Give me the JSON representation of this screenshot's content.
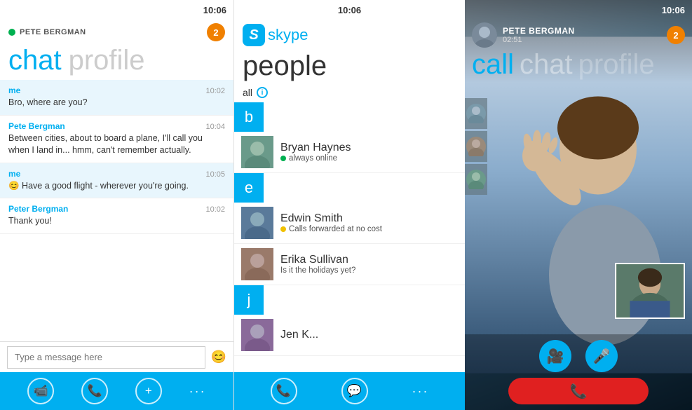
{
  "panel_chat": {
    "status_bar": {
      "time": "10:06"
    },
    "header": {
      "user_name": "PETE BERGMAN",
      "badge_count": "2"
    },
    "title": {
      "chat": "chat",
      "profile": "profile"
    },
    "messages": [
      {
        "sender": "me",
        "time": "10:02",
        "text": "Bro, where are you?",
        "highlighted": true
      },
      {
        "sender": "Pete Bergman",
        "time": "10:04",
        "text": "Between cities, about to board a plane, I'll call you when I land in... hmm, can't remember actually.",
        "highlighted": false
      },
      {
        "sender": "me",
        "time": "10:05",
        "text": "😊 Have a good flight - wherever you're going.",
        "highlighted": true
      },
      {
        "sender": "Peter Bergman",
        "time": "10:02",
        "text": "Thank you!",
        "highlighted": false
      }
    ],
    "input_placeholder": "Type a message here",
    "toolbar": {
      "btn_video": "📹",
      "btn_phone": "📞",
      "btn_add": "+",
      "dots": "..."
    }
  },
  "panel_people": {
    "status_bar": {
      "time": "10:06"
    },
    "skype_label": "skype",
    "title": "people",
    "filter": {
      "label": "all",
      "info": "i"
    },
    "sections": [
      {
        "letter": "b",
        "contacts": [
          {
            "name": "Bryan Haynes",
            "status": "always online",
            "status_type": "online"
          }
        ]
      },
      {
        "letter": "e",
        "contacts": [
          {
            "name": "Edwin Smith",
            "status": "Calls forwarded at no cost",
            "status_type": "forward"
          },
          {
            "name": "Erika Sullivan",
            "status": "Is it the holidays yet?",
            "status_type": "none"
          }
        ]
      },
      {
        "letter": "j",
        "contacts": [
          {
            "name": "Jen K...",
            "status": "",
            "status_type": "none"
          }
        ]
      }
    ],
    "toolbar": {
      "btn_phone": "📞",
      "btn_chat": "💬",
      "dots": "..."
    }
  },
  "panel_call": {
    "status_bar": {
      "time": "10:06"
    },
    "header": {
      "caller_name": "PETE BERGMAN",
      "duration": "02:51",
      "badge_count": "2"
    },
    "title": {
      "call": "call",
      "chat": "chat",
      "profile": "profile"
    },
    "controls": {
      "btn_video": "📷",
      "btn_mic": "🎤",
      "btn_end": "📞"
    }
  }
}
